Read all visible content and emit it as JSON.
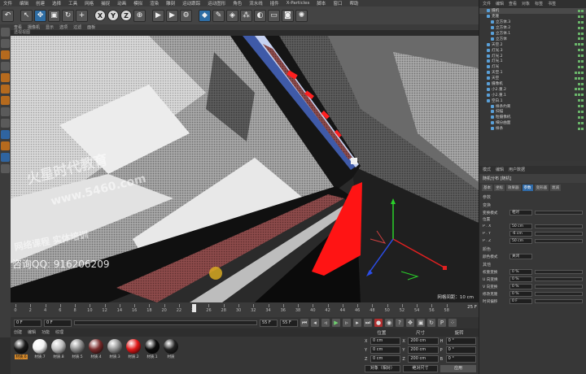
{
  "menubar": [
    "文件",
    "编辑",
    "创建",
    "选择",
    "工具",
    "网格",
    "捕捉",
    "动画",
    "模拟",
    "渲染",
    "雕刻",
    "运动跟踪",
    "运动图形",
    "角色",
    "流水线",
    "插件",
    "X-Particles",
    "脚本",
    "窗口",
    "帮助"
  ],
  "toolbar": {
    "axis_x": "X",
    "axis_y": "Y",
    "axis_z": "Z"
  },
  "viewport": {
    "menu": [
      "查看",
      "摄像机",
      "显示",
      "选项",
      "过滤",
      "面板"
    ],
    "camera_label": "透视视图",
    "scale_readout": "网格间距：10 cm",
    "watermark": {
      "line1": "火星时代教育",
      "line2": "www.5460.com",
      "line3": "网络课程 实体培训",
      "line4": "咨询QQ: 916206209"
    }
  },
  "timeline": {
    "ticks": [
      0,
      2,
      4,
      6,
      8,
      10,
      12,
      14,
      16,
      18,
      20,
      22,
      24,
      26,
      28,
      30,
      32,
      34,
      36,
      38,
      40,
      42,
      44,
      46,
      48,
      50,
      52,
      54,
      56,
      58
    ],
    "max_frame": 60,
    "current_frame": 24,
    "end_label": "25 F"
  },
  "transport": {
    "start": "0 F",
    "min": "0 F",
    "max": "55 F",
    "end": "55 F"
  },
  "materials": {
    "tabs": [
      "创建",
      "编辑",
      "功能",
      "纹理"
    ],
    "items": [
      {
        "label": "材质.6",
        "color": "#1a1a1a",
        "selected": true
      },
      {
        "label": "材质.7",
        "color": "#f2f2f2",
        "selected": false
      },
      {
        "label": "材质.8",
        "color": "#bdbdbd",
        "selected": false
      },
      {
        "label": "材质.5",
        "color": "#8a8a8a",
        "selected": false
      },
      {
        "label": "材质.4",
        "color": "#7a2b2b",
        "selected": false
      },
      {
        "label": "材质.3",
        "color": "#8f8f8f",
        "selected": false
      },
      {
        "label": "材质.2",
        "color": "#e01818",
        "selected": false
      },
      {
        "label": "材质.1",
        "color": "#0d0d0d",
        "selected": false
      },
      {
        "label": "材质",
        "color": "#222222",
        "selected": false
      }
    ]
  },
  "coordinates": {
    "headers": [
      "位置",
      "尺寸",
      "旋转"
    ],
    "rows": [
      {
        "axis": "X",
        "pos": "0 cm",
        "size": "200 cm",
        "rot_label": "H",
        "rot": "0 °"
      },
      {
        "axis": "Y",
        "pos": "0 cm",
        "size": "200 cm",
        "rot_label": "P",
        "rot": "0 °"
      },
      {
        "axis": "Z",
        "pos": "0 cm",
        "size": "200 cm",
        "rot_label": "B",
        "rot": "0 °"
      }
    ],
    "mode": "对象（相对）",
    "size_mode": "绝对尺寸",
    "apply": "应用"
  },
  "objects": {
    "tabs": [
      "文件",
      "编辑",
      "查看",
      "对象",
      "标签",
      "书签"
    ],
    "rows": [
      {
        "name": "摄机",
        "indent": 1,
        "tags": 2
      },
      {
        "name": "克隆",
        "indent": 1,
        "tags": 2
      },
      {
        "name": "立方体.3",
        "indent": 2,
        "tags": 2
      },
      {
        "name": "立方体.2",
        "indent": 2,
        "tags": 2
      },
      {
        "name": "立方体.1",
        "indent": 2,
        "tags": 2
      },
      {
        "name": "立方体",
        "indent": 2,
        "tags": 2
      },
      {
        "name": "天空.2",
        "indent": 1,
        "tags": 3
      },
      {
        "name": "灯光.3",
        "indent": 1,
        "tags": 2
      },
      {
        "name": "灯光.2",
        "indent": 1,
        "tags": 2
      },
      {
        "name": "灯光.1",
        "indent": 1,
        "tags": 2
      },
      {
        "name": "灯光",
        "indent": 1,
        "tags": 2
      },
      {
        "name": "天空.1",
        "indent": 1,
        "tags": 3
      },
      {
        "name": "天空",
        "indent": 1,
        "tags": 3
      },
      {
        "name": "摄像机",
        "indent": 1,
        "tags": 2
      },
      {
        "name": "小2.重.2",
        "indent": 1,
        "tags": 3
      },
      {
        "name": "小2.重.1",
        "indent": 1,
        "tags": 3
      },
      {
        "name": "空白.1",
        "indent": 1,
        "tags": 2
      },
      {
        "name": "样条约束",
        "indent": 2,
        "tags": 2
      },
      {
        "name": "扫描",
        "indent": 2,
        "tags": 2
      },
      {
        "name": "粒摄像机",
        "indent": 2,
        "tags": 2
      },
      {
        "name": "细分曲面",
        "indent": 2,
        "tags": 2
      },
      {
        "name": "样条",
        "indent": 2,
        "tags": 2
      }
    ]
  },
  "attributes": {
    "tabs": [
      "模式",
      "编辑",
      "用户数据"
    ],
    "title": "随机分布 [随机]",
    "subtabs": [
      "基本",
      "坐标",
      "效果器",
      "参数",
      "变形器",
      "衰减"
    ],
    "active_subtab": "参数",
    "section1": "参数",
    "section2": "变换",
    "rows1": [
      {
        "label": "变换模式",
        "value": "相对"
      },
      {
        "label": "位置",
        "value": ""
      },
      {
        "label": "P . X",
        "value": "50 cm"
      },
      {
        "label": "P . Y",
        "value": "-6 cm"
      },
      {
        "label": "P . Z",
        "value": "50 cm"
      }
    ],
    "section3": "颜色",
    "color_mode": "关闭",
    "section4": "其他",
    "rows2": [
      {
        "label": "权重变换",
        "value": "0 %"
      },
      {
        "label": "U 向变换",
        "value": "0 %"
      },
      {
        "label": "V 向变换",
        "value": "0 %"
      },
      {
        "label": "修改克隆",
        "value": "0 %"
      },
      {
        "label": "时间偏移",
        "value": "0 F"
      }
    ]
  }
}
